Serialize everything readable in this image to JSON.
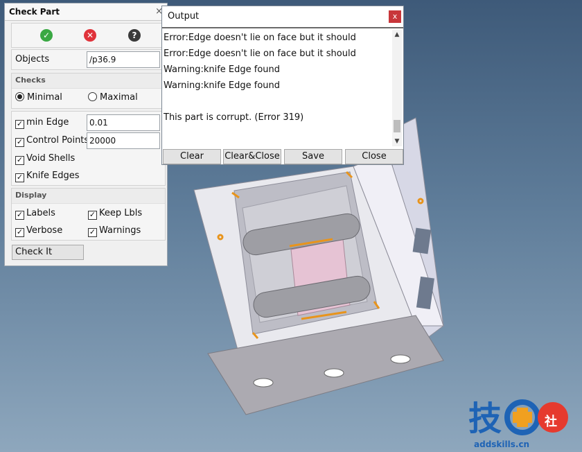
{
  "check_part": {
    "title": "Check Part",
    "close": "×",
    "icons": [
      "ok-icon",
      "cancel-icon",
      "help-icon"
    ],
    "objects_label": "Objects",
    "objects_value": "/p36.9",
    "checks_header": "Checks",
    "mode_minimal": "Minimal",
    "mode_maximal": "Maximal",
    "selected_mode": "Minimal",
    "min_edge_label": "min Edge",
    "min_edge_value": "0.01",
    "min_edge_checked": true,
    "control_points_label": "Control Points",
    "control_points_value": "20000",
    "control_points_checked": true,
    "void_shells_label": "Void Shells",
    "void_shells_checked": true,
    "knife_edges_label": "Knife Edges",
    "knife_edges_checked": true,
    "display_header": "Display",
    "labels_label": "Labels",
    "keep_lbls_label": "Keep Lbls",
    "verbose_label": "Verbose",
    "warnings_label": "Warnings",
    "check_it_label": "Check It"
  },
  "output": {
    "title": "Output",
    "close": "x",
    "lines": [
      "Error:Edge doesn't lie on face but it should",
      "Error:Edge doesn't lie on face but it should",
      "Warning:knife Edge found",
      "Warning:knife Edge found",
      "",
      "This part is corrupt.   (Error 319)"
    ],
    "buttons": {
      "clear": "Clear",
      "clear_close": "Clear&Close",
      "save": "Save",
      "close": "Close"
    }
  },
  "watermark": {
    "text": "addskills.cn"
  },
  "colors": {
    "ok": "#3aa843",
    "cancel": "#e0333b",
    "help": "#3a3a3a",
    "highlight": "#e8941c",
    "close_btn": "#c8363a"
  }
}
